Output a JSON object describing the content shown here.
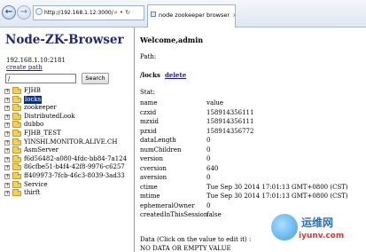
{
  "browser": {
    "url": "http://192.168.1.12:3000/",
    "tab_title": "node zookeeper browser",
    "addr_controls": "⌕ • ↻",
    "tab_close": "×"
  },
  "sidebar": {
    "title": "Node-ZK-Browser",
    "server": "192.168.1.10:2181",
    "create_path": "create path",
    "search_value": "/",
    "search_button": "Search",
    "items": [
      {
        "label": "FJHB",
        "selected": false
      },
      {
        "label": "locks",
        "selected": true
      },
      {
        "label": "zookeeper",
        "selected": false
      },
      {
        "label": "DistributedLook",
        "selected": false
      },
      {
        "label": "dubbo",
        "selected": false
      },
      {
        "label": "FJHB_TEST",
        "selected": false
      },
      {
        "label": "YINSHI.MONITOR.ALIVE.CH",
        "selected": false
      },
      {
        "label": "AsmServer",
        "selected": false
      },
      {
        "label": "f6d56482-a080-4fdc-bb84-7a124",
        "selected": false
      },
      {
        "label": "86cfbe51-b4f4-42f8-9976-c6257",
        "selected": false
      },
      {
        "label": "ff409973-7fcb-46c3-8039-3ad33",
        "selected": false
      },
      {
        "label": "Service",
        "selected": false
      },
      {
        "label": "thirft",
        "selected": false
      }
    ]
  },
  "main": {
    "welcome": "Welcome,admin",
    "path_label": "Path:",
    "current_path": "/locks",
    "delete_label": "delete",
    "stat_label": "Stat:",
    "stat": [
      {
        "key": "name",
        "value": "value"
      },
      {
        "key": "czxid",
        "value": "158914356111"
      },
      {
        "key": "mzxid",
        "value": "158914356111"
      },
      {
        "key": "pzxid",
        "value": "158914356772"
      },
      {
        "key": "dataLength",
        "value": "0"
      },
      {
        "key": "numChildren",
        "value": "0"
      },
      {
        "key": "version",
        "value": "0"
      },
      {
        "key": "cversion",
        "value": "640"
      },
      {
        "key": "aversion",
        "value": "0"
      },
      {
        "key": "ctime",
        "value": "Tue Sep 30 2014 17:01:13 GMT+0800 (CST)"
      },
      {
        "key": "mtime",
        "value": "Tue Sep 30 2014 17:01:13 GMT+0800 (CST)"
      },
      {
        "key": "ephemeralOwner",
        "value": "0"
      },
      {
        "key": "createdInThisSession",
        "value": "false"
      }
    ],
    "data_line": "Data (Click on the value to edit it) :",
    "no_data": "NO DATA OR EMPTY VALUE"
  },
  "watermark": {
    "cn": "运维网",
    "url": "iyunv.com"
  }
}
